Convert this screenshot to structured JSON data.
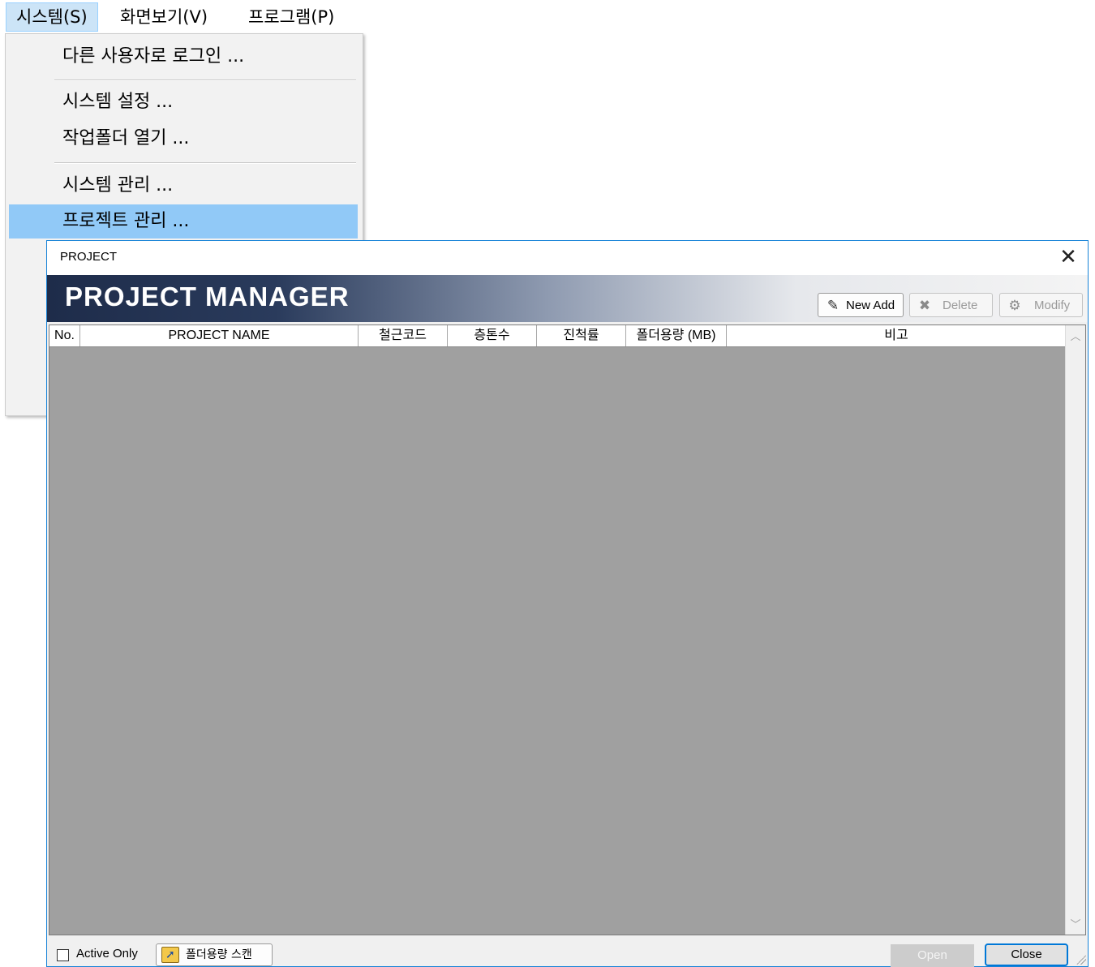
{
  "menubar": {
    "items": [
      {
        "label": "시스템(S)"
      },
      {
        "label": "화면보기(V)"
      },
      {
        "label": "프로그램(P)"
      }
    ]
  },
  "dropdown": {
    "items": [
      {
        "label": "다른 사용자로 로그인 ..."
      },
      {
        "label": "시스템 설정 ..."
      },
      {
        "label": "작업폴더 열기 ..."
      },
      {
        "label": "시스템 관리 ..."
      },
      {
        "label": "프로젝트 관리 ..."
      }
    ]
  },
  "dialog": {
    "title": "PROJECT",
    "close_glyph": "✕",
    "banner_title": "PROJECT MANAGER",
    "toolbar": {
      "new_add": "New Add",
      "delete": "Delete",
      "modify": "Modify"
    },
    "grid": {
      "columns": [
        "No.",
        "PROJECT NAME",
        "철근코드",
        "층톤수",
        "진척률",
        "폴더용량 (MB)",
        "비고"
      ],
      "rows": []
    },
    "footer": {
      "active_only": "Active Only",
      "scan_button": "폴더용량 스캔",
      "open_button": "Open",
      "close_button": "Close"
    }
  }
}
